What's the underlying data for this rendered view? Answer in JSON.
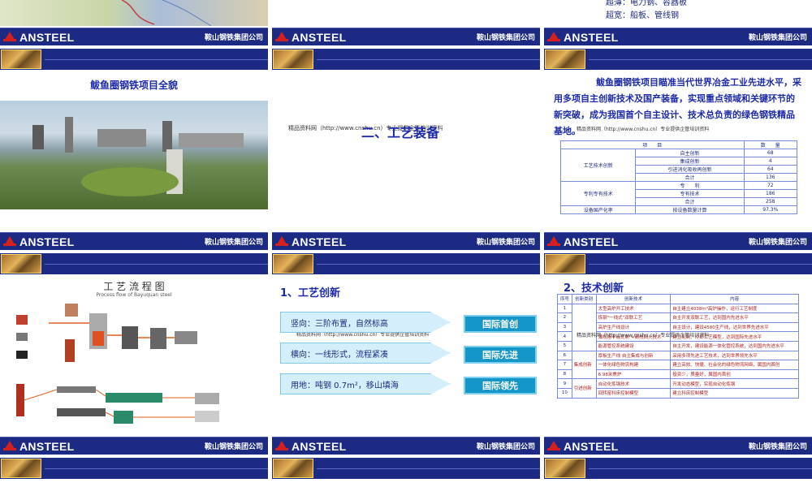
{
  "brand": {
    "logo": "ANSTEEL",
    "company": "鞍山钢铁集团公司"
  },
  "slide3_top": {
    "line1": "超薄：电力钢、容器板",
    "line2": "超宽：船板、管线钢"
  },
  "slide4": {
    "title": "鲅鱼圈钢铁项目全貌"
  },
  "slide5": {
    "title": "二、工艺装备",
    "watermark": "精品资料网（http://www.cnshu.cn）专业提供企管培训资料"
  },
  "slide6": {
    "paragraph": "鲅鱼圈钢铁项目瞄准当代世界冶金工业先进水平，采用多项自主创新技术及国产装备，实现重点领域和关键环节的新突破，成为我国首个自主设计、技术总负责的绿色钢铁精品基地。",
    "watermark": "精品资料网（http://www.cnshu.cn）专业提供企管培训资料",
    "table": {
      "headers": [
        "项　　目",
        "数　　量"
      ],
      "rows": [
        {
          "group": "工艺技术创新",
          "item": "自主创新",
          "value": "68"
        },
        {
          "group": "",
          "item": "集成创新",
          "value": "4"
        },
        {
          "group": "",
          "item": "引进消化吸收再创新",
          "value": "64"
        },
        {
          "group": "",
          "item": "合计",
          "value": "136"
        },
        {
          "group": "专利专有技术",
          "item": "专　　利",
          "value": "72"
        },
        {
          "group": "",
          "item": "专有技术",
          "value": "186"
        },
        {
          "group": "",
          "item": "合计",
          "value": "258"
        },
        {
          "group": "设备国产化率",
          "item": "按设备数量计算",
          "value": "97.3%"
        }
      ]
    }
  },
  "slide7": {
    "title": "工 艺 流 程 图",
    "subtitle": "Process flow of Bayuquan steel"
  },
  "slide8": {
    "heading": "1、工艺创新",
    "watermark": "精品资料网（http://www.cnshu.cn）专业提供企管培训资料",
    "items": [
      {
        "label": "竖向：三阶布置，自然标高",
        "badge": "国际首创"
      },
      {
        "label": "横向：一线形式，流程紧凑",
        "badge": "国际先进"
      },
      {
        "label": "用地：吨钢 0.7m²，移山填海",
        "badge": "国际领先"
      }
    ]
  },
  "slide9": {
    "heading": "2、技术创新",
    "watermark": "精品资料网（http://www.cnshu.cn）专业提供企管培训资料",
    "headers": [
      "序号",
      "创新类别",
      "创新技术",
      "内容"
    ],
    "rows": [
      {
        "no": "1",
        "cat": "",
        "tech": "大型高炉开工技术",
        "content": "自主建立4038m³高炉操作，运行工艺制度"
      },
      {
        "no": "2",
        "cat": "",
        "tech": "炼钢\"一线式\"双联工艺",
        "content": "自主开发双联工艺，达到国内先进水平"
      },
      {
        "no": "3",
        "cat": "",
        "tech": "高炉生产线设计",
        "content": "自主设计，建设4580生产线，达到世界先进水平"
      },
      {
        "no": "4",
        "cat": "",
        "tech": "薄规格平板轧制\n+离线回火技术",
        "content": "建立轧制、冷却工艺模型，达到国际先进水平"
      },
      {
        "no": "5",
        "cat": "",
        "tech": "能源管控系统建设",
        "content": "自主开发，建设能源一体化管控系统，达到国内先进水平"
      },
      {
        "no": "6",
        "cat": "集成创新",
        "tech": "厚板生产线\n自主集成与创新",
        "content": "采用多项先进工艺技术，达到世界领先水平"
      },
      {
        "no": "7",
        "cat": "",
        "tech": "一体化绿色物流构建",
        "content": "建立高效、快捷、社会化的绿色物流网络，属国内首创"
      },
      {
        "no": "8",
        "cat": "",
        "tech": "6.98米焦炉",
        "content": "投资少，质量好，属国内首创"
      },
      {
        "no": "9",
        "cat": "引进创新",
        "tech": "自动化炼钢技术",
        "content": "开发动态模型，实现自动化炼钢"
      },
      {
        "no": "10",
        "cat": "",
        "tech": "回转窑科床控制模型",
        "content": "建立科床控制模型"
      }
    ]
  },
  "colors": {
    "bar": "#1c2a84",
    "accent": "#1c2aa8",
    "badge": "#1596c8"
  }
}
